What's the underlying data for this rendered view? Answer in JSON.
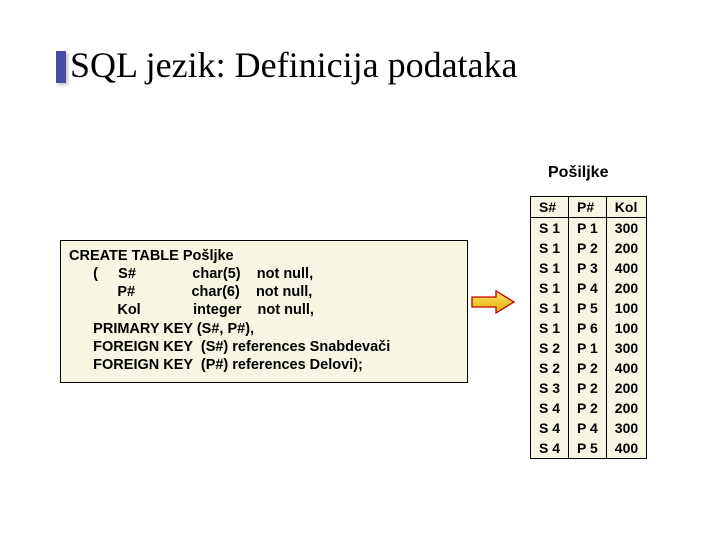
{
  "title": "SQL jezik: Definicija podataka",
  "code": [
    "CREATE TABLE Pošljke",
    "(     S#              char(5)    not null,",
    "P#              char(6)    not null,",
    "Kol             integer    not null,",
    "PRIMARY KEY (S#, P#),",
    "FOREIGN KEY  (S#) references Snabdevači",
    "FOREIGN KEY  (P#) references Delovi);"
  ],
  "table": {
    "caption": "Pošiljke",
    "headers": [
      "S#",
      "P#",
      "Kol"
    ],
    "rows": [
      [
        "S 1",
        "P 1",
        "300"
      ],
      [
        "S 1",
        "P 2",
        "200"
      ],
      [
        "S 1",
        "P 3",
        "400"
      ],
      [
        "S 1",
        "P 4",
        "200"
      ],
      [
        "S 1",
        "P 5",
        "100"
      ],
      [
        "S 1",
        "P 6",
        "100"
      ],
      [
        "S 2",
        "P 1",
        "300"
      ],
      [
        "S 2",
        "P 2",
        "400"
      ],
      [
        "S 3",
        "P 2",
        "200"
      ],
      [
        "S 4",
        "P 2",
        "200"
      ],
      [
        "S 4",
        "P 4",
        "300"
      ],
      [
        "S 4",
        "P 5",
        "400"
      ]
    ]
  }
}
